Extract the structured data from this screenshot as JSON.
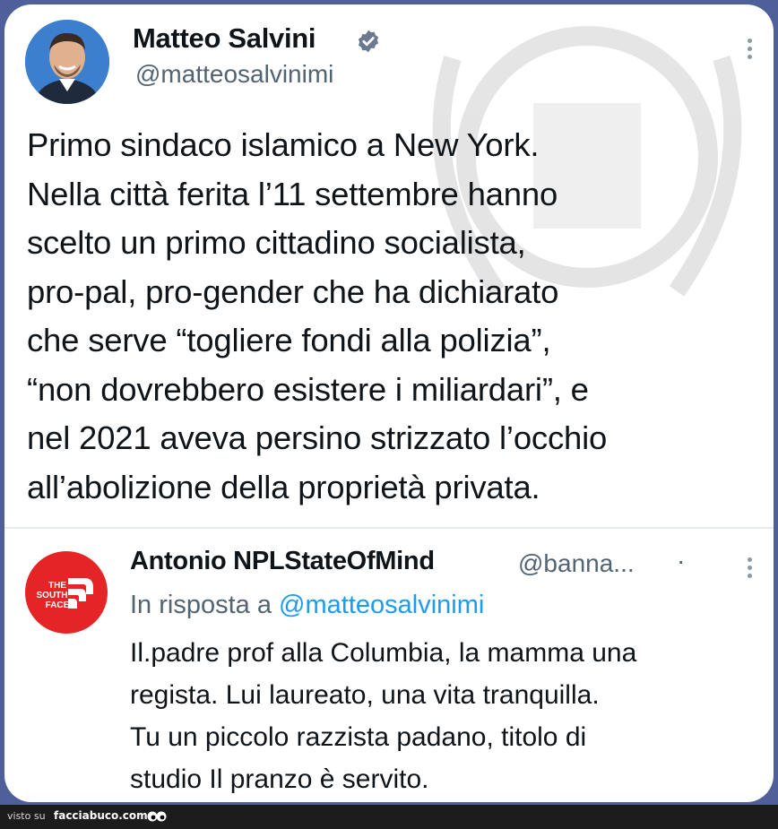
{
  "tweet": {
    "author_name": "Matteo Salvini",
    "handle": "@matteosalvinimi",
    "lines": [
      "Primo sindaco islamico a New York.",
      "Nella città ferita l’11 settembre hanno",
      "scelto un primo cittadino socialista,",
      "pro-pal, pro-gender che ha dichiarato",
      "che serve “togliere fondi alla polizia”,",
      "“non dovrebbero esistere i miliardari”, e",
      "nel 2021 aveva persino strizzato l’occhio",
      "all’abolizione della proprietà privata."
    ],
    "icons": {
      "verified": "verified-badge-icon",
      "more": "more-options-icon"
    }
  },
  "reply": {
    "author_name": "Antonio NPLStateOfMind",
    "handle": "@banna...",
    "separator": "·",
    "replying_to_prefix": "In risposta a",
    "replying_to_handle": "@matteosalvinimi",
    "lines": [
      "Il.padre prof alla Columbia, la mamma una",
      "regista. Lui laureato, una vita tranquilla.",
      "Tu un piccolo razzista padano, titolo di",
      "studio Il pranzo è servito."
    ],
    "avatar_logo": "THE SOUTH FACE"
  },
  "footer": {
    "visto_su": "visto su",
    "site": "facciabuco.com"
  },
  "colors": {
    "background": "#4f5f9a",
    "card": "#ffffff",
    "text_primary": "#0f1419",
    "text_secondary": "#536471",
    "link": "#1d9bf0",
    "reply_avatar": "#e52425",
    "footer": "#1c1c1c"
  }
}
